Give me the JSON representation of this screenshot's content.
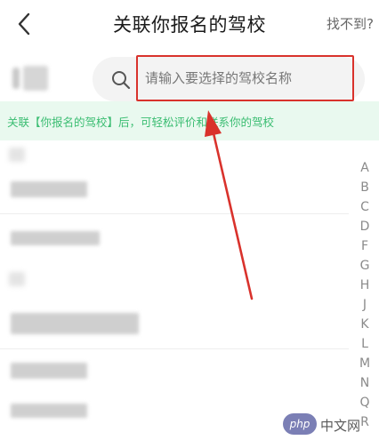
{
  "header": {
    "title": "关联你报名的驾校",
    "not_found": "找不到?"
  },
  "search": {
    "placeholder": "请输入要选择的驾校名称"
  },
  "banner": {
    "text": "关联【你报名的驾校】后，可轻松评价和联系你的驾校"
  },
  "index_letters": [
    "A",
    "B",
    "C",
    "D",
    "F",
    "G",
    "H",
    "J",
    "K",
    "L",
    "M",
    "N",
    "Q",
    "R"
  ],
  "watermark": {
    "badge": "php",
    "text": "中文网"
  },
  "colors": {
    "accent_green": "#3bbd72",
    "banner_bg": "#e9f9ef",
    "highlight_red": "#d9322c"
  }
}
